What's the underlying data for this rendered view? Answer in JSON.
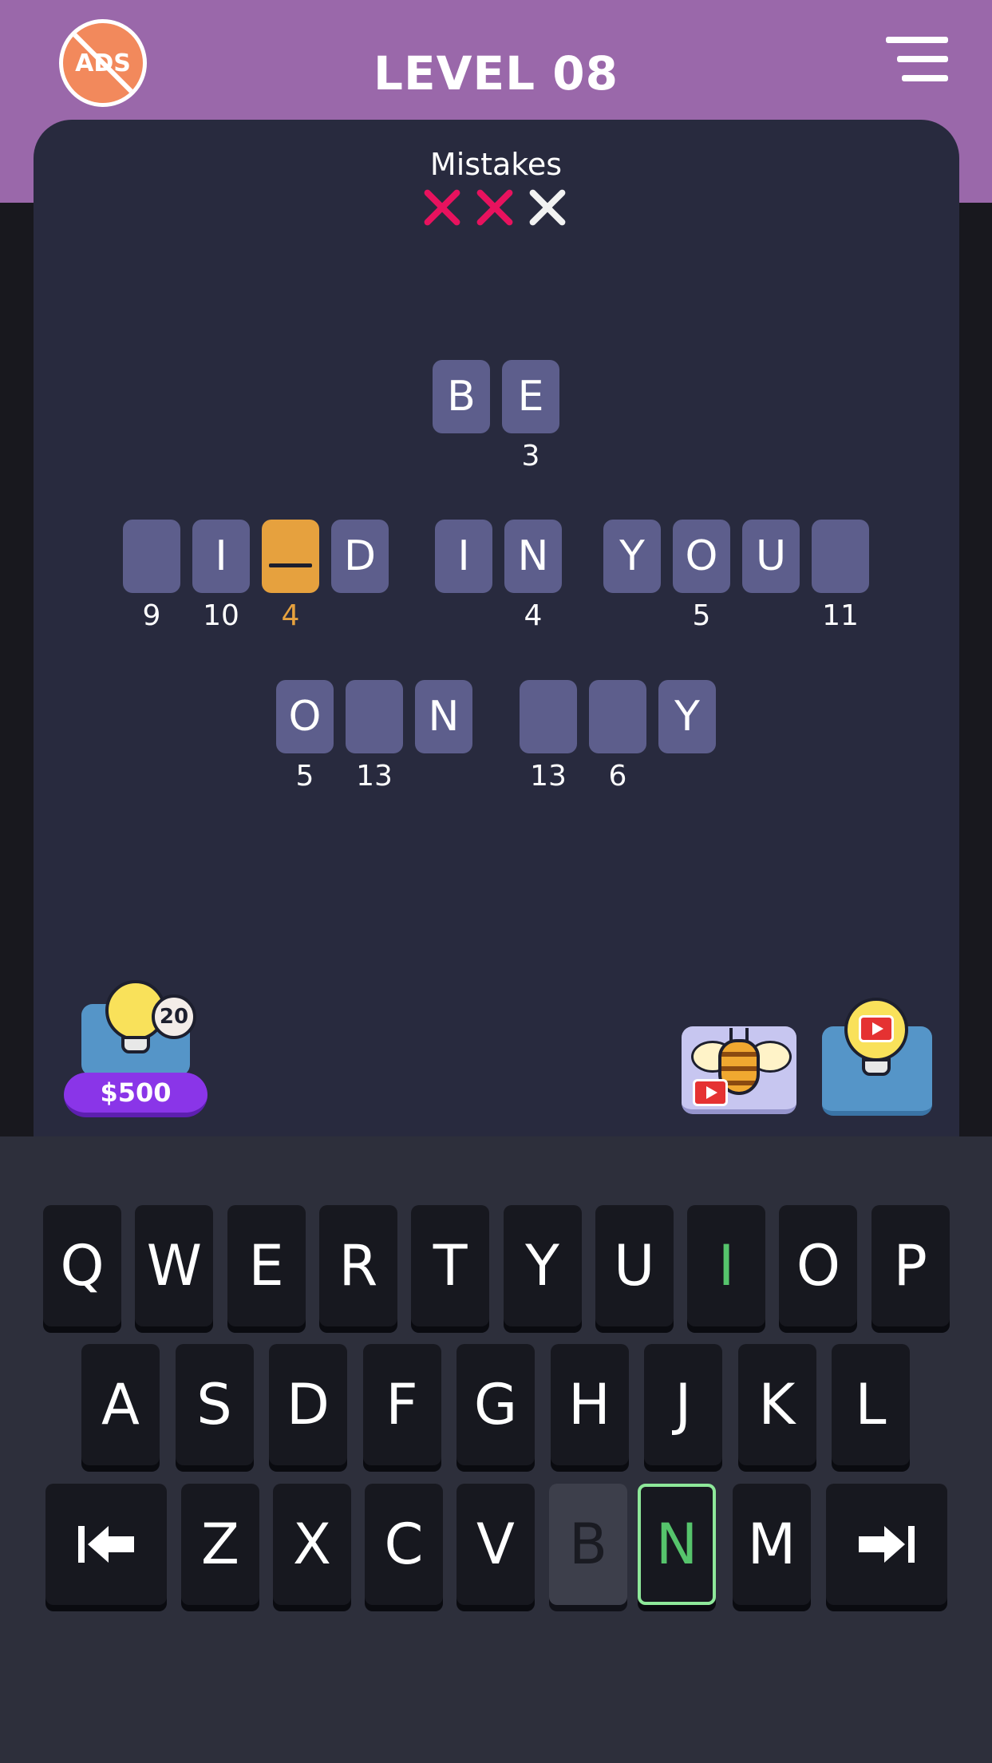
{
  "header": {
    "ads_label": "ADS",
    "level_title": "LEVEL 08"
  },
  "mistakes": {
    "label": "Mistakes",
    "used": 2,
    "max": 3
  },
  "puzzle": {
    "rows": [
      [
        {
          "letter": "B",
          "number": ""
        },
        {
          "letter": "E",
          "number": "3"
        }
      ],
      [
        {
          "letter": "",
          "number": "9"
        },
        {
          "letter": "I",
          "number": "10"
        },
        {
          "letter": "",
          "number": "4",
          "active": true
        },
        {
          "letter": "D",
          "number": ""
        },
        {
          "letter": "I",
          "number": ""
        },
        {
          "letter": "N",
          "number": "4"
        },
        {
          "letter": "Y",
          "number": ""
        },
        {
          "letter": "O",
          "number": "5"
        },
        {
          "letter": "U",
          "number": ""
        },
        {
          "letter": "",
          "number": "11"
        }
      ],
      [
        {
          "letter": "O",
          "number": "5"
        },
        {
          "letter": "",
          "number": "13"
        },
        {
          "letter": "N",
          "number": ""
        },
        {
          "letter": "",
          "number": "13"
        },
        {
          "letter": "",
          "number": "6"
        },
        {
          "letter": "Y",
          "number": ""
        }
      ]
    ]
  },
  "powerups": {
    "hint_count": "20",
    "hint_price": "$500"
  },
  "keyboard": {
    "row1": [
      "Q",
      "W",
      "E",
      "R",
      "T",
      "Y",
      "U",
      "I",
      "O",
      "P"
    ],
    "row2": [
      "A",
      "S",
      "D",
      "F",
      "G",
      "H",
      "J",
      "K",
      "L"
    ],
    "row3": [
      "Z",
      "X",
      "C",
      "V",
      "B",
      "N",
      "M"
    ],
    "correct_keys": [
      "I"
    ],
    "disabled_keys": [
      "B"
    ],
    "selected_key": "N"
  },
  "colors": {
    "header": "#9a68aa",
    "panel": "#282a3e",
    "tile": "#5d5e8c",
    "active_tile": "#e6a13e",
    "mistake_used": "#e8125e",
    "correct_key": "#56c46c"
  }
}
